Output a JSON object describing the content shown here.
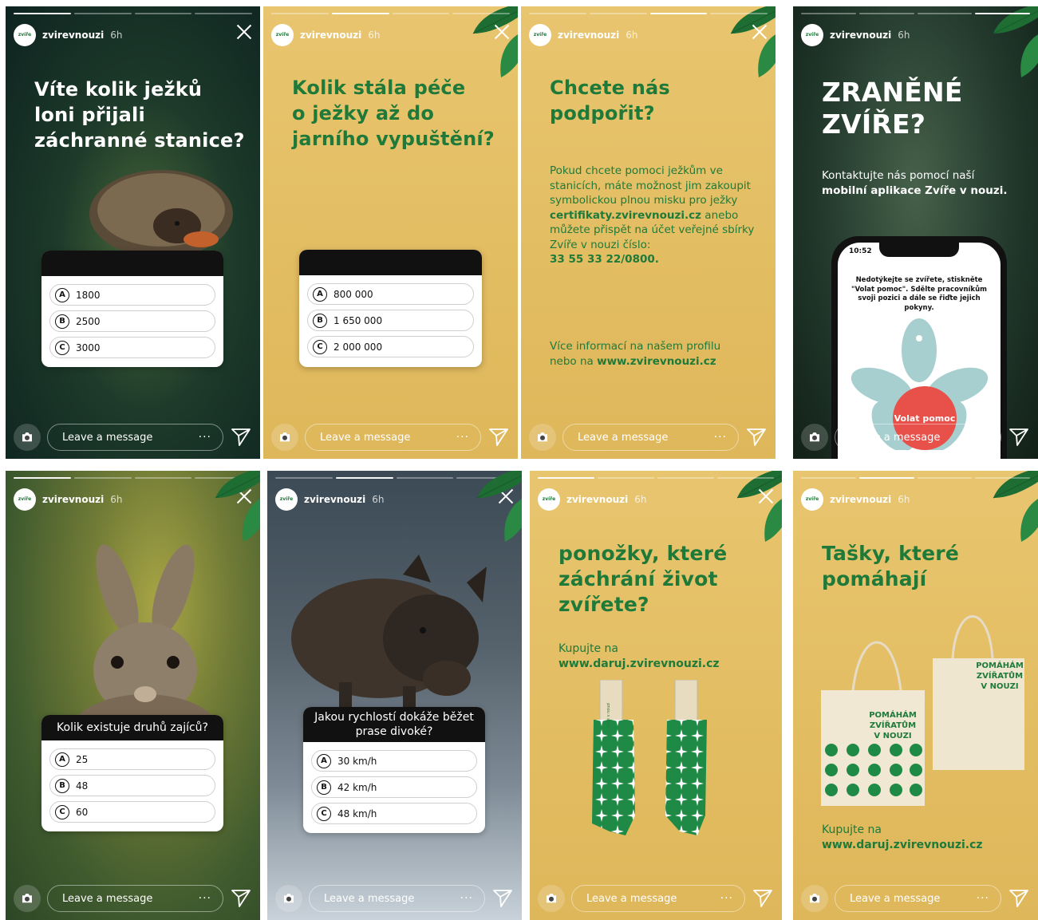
{
  "common": {
    "username": "zvirevnouzi",
    "time": "6h",
    "message_placeholder": "Leave a message",
    "more": "···",
    "logo_text_1": "zvíře",
    "logo_text_2": "v nouzi"
  },
  "stories": {
    "s1": {
      "headline": [
        "Víte kolik ježků",
        "loni přijali",
        "záchranné stanice?"
      ],
      "options": [
        {
          "letter": "A",
          "text": "1800"
        },
        {
          "letter": "B",
          "text": "2500"
        },
        {
          "letter": "C",
          "text": "3000"
        }
      ]
    },
    "s2": {
      "headline": [
        "Kolik stála péče",
        "o ježky až do",
        "jarního vypuštění?"
      ],
      "options": [
        {
          "letter": "A",
          "text": "800 000"
        },
        {
          "letter": "B",
          "text": "1 650 000"
        },
        {
          "letter": "C",
          "text": "2 000 000"
        }
      ]
    },
    "s3": {
      "headline": [
        "Chcete nás",
        "podpořit?"
      ],
      "para1_a": "Pokud chcete pomoci ježkům ve stanicích, máte možnost jim zakoupit symbolickou plnou misku pro ježky ",
      "para1_link": "certifikaty.zvirevnouzi.cz",
      "para1_b": " anebo můžete přispět na účet veřejné sbírky Zvíře v nouzi číslo:",
      "account": "33 55 33 22/0800.",
      "para2_a": "Více informací na našem profilu nebo na ",
      "para2_link": "www.zvirevnouzi.cz"
    },
    "s4": {
      "headline": [
        "ZRANĚNÉ",
        "ZVÍŘE?"
      ],
      "text_a": "Kontaktujte nás pomocí naší",
      "text_b": "mobilní aplikace Zvíře v nouzi.",
      "phone_time": "10:52",
      "phone_text": "Nedotýkejte se zvířete, stiskněte \"Volat pomoc\". Sdělte pracovníkům svoji pozici a dále se řiďte jejich pokyny.",
      "phone_button": "Volat pomoc"
    },
    "s5": {
      "question": "Kolik existuje druhů zajíců?",
      "options": [
        {
          "letter": "A",
          "text": "25"
        },
        {
          "letter": "B",
          "text": "48"
        },
        {
          "letter": "C",
          "text": "60"
        }
      ]
    },
    "s6": {
      "question": "Jakou rychlostí dokáže běžet prase divoké?",
      "options": [
        {
          "letter": "A",
          "text": "30 km/h"
        },
        {
          "letter": "B",
          "text": "42 km/h"
        },
        {
          "letter": "C",
          "text": "48 km/h"
        }
      ]
    },
    "s7": {
      "headline": [
        "ponožky, které",
        "záchrání život",
        "zvířete?"
      ],
      "buy": "Kupujte na",
      "link": "www.daruj.zvirevnouzi.cz",
      "tag_text": "Ponožky, které pomáhají"
    },
    "s8": {
      "headline": [
        "Tašky, které",
        "pomáhají"
      ],
      "buy": "Kupujte na",
      "link": "www.daruj.zvirevnouzi.cz",
      "bag_text": [
        "POMÁHÁM",
        "ZVÍŘATŮM",
        "V NOUZI"
      ]
    }
  },
  "colors": {
    "brand_green": "#1f7a3a",
    "yellow": "#e3bd62",
    "red_button": "#e7514a"
  }
}
